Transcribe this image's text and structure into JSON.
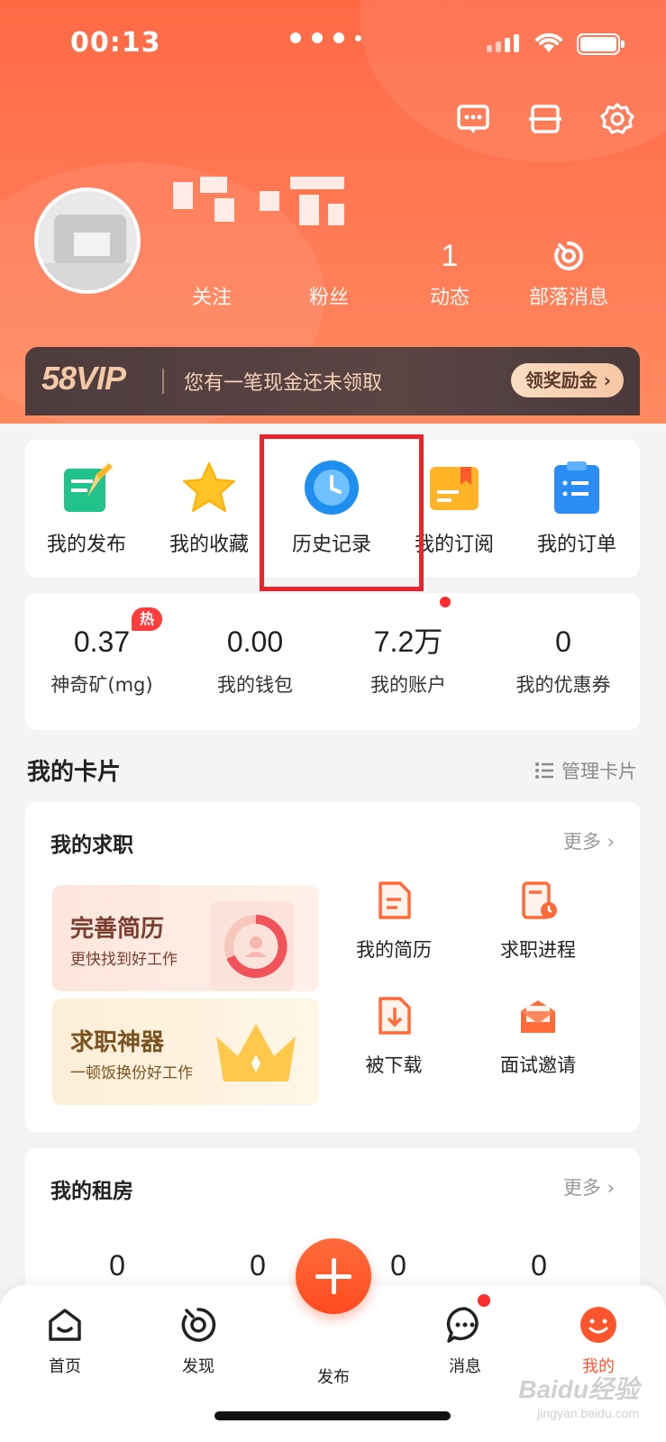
{
  "status_bar": {
    "time": "00:13"
  },
  "profile": {
    "stats": [
      {
        "value": "",
        "label": "关注"
      },
      {
        "value": "",
        "label": "粉丝"
      },
      {
        "value": "1",
        "label": "动态"
      },
      {
        "value": "",
        "label": "部落消息"
      }
    ]
  },
  "vip": {
    "logo": "58VIP",
    "text": "您有一笔现金还未领取",
    "button": "领奖励金 ›"
  },
  "shortcuts": [
    {
      "label": "我的发布",
      "icon": "publish-icon"
    },
    {
      "label": "我的收藏",
      "icon": "star-icon"
    },
    {
      "label": "历史记录",
      "icon": "clock-icon"
    },
    {
      "label": "我的订阅",
      "icon": "subscribe-icon"
    },
    {
      "label": "我的订单",
      "icon": "order-icon"
    }
  ],
  "wallet": {
    "hot_badge": "热",
    "items": [
      {
        "value": "0.37",
        "label": "神奇矿(mg)"
      },
      {
        "value": "0.00",
        "label": "我的钱包"
      },
      {
        "value": "7.2万",
        "label": "我的账户"
      },
      {
        "value": "0",
        "label": "我的优惠券"
      }
    ]
  },
  "cards_section": {
    "title": "我的卡片",
    "manage": "管理卡片"
  },
  "jobs_card": {
    "title": "我的求职",
    "more": "更多 ›",
    "promo1": {
      "title": "完善简历",
      "subtitle": "更快找到好工作"
    },
    "promo2": {
      "title": "求职神器",
      "subtitle": "一顿饭换份好工作"
    },
    "items": [
      {
        "label": "我的简历",
        "icon": "resume-icon"
      },
      {
        "label": "求职进程",
        "icon": "progress-icon"
      },
      {
        "label": "被下载",
        "icon": "download-icon"
      },
      {
        "label": "面试邀请",
        "icon": "invite-icon"
      }
    ]
  },
  "rent_card": {
    "title": "我的租房",
    "more": "更多 ›",
    "values": [
      "0",
      "0",
      "0",
      "0"
    ]
  },
  "bottom_nav": [
    {
      "label": "首页",
      "icon": "home-icon"
    },
    {
      "label": "发现",
      "icon": "discover-icon"
    },
    {
      "label": "发布",
      "icon": "plus-icon"
    },
    {
      "label": "消息",
      "icon": "message-icon"
    },
    {
      "label": "我的",
      "icon": "me-icon"
    }
  ],
  "watermark": {
    "brand": "Baidu经验",
    "url": "jingyan.baidu.com"
  },
  "colors": {
    "brand": "#ff552e",
    "highlight": "#e8262d",
    "vip_bg": "#4e3c3d"
  }
}
